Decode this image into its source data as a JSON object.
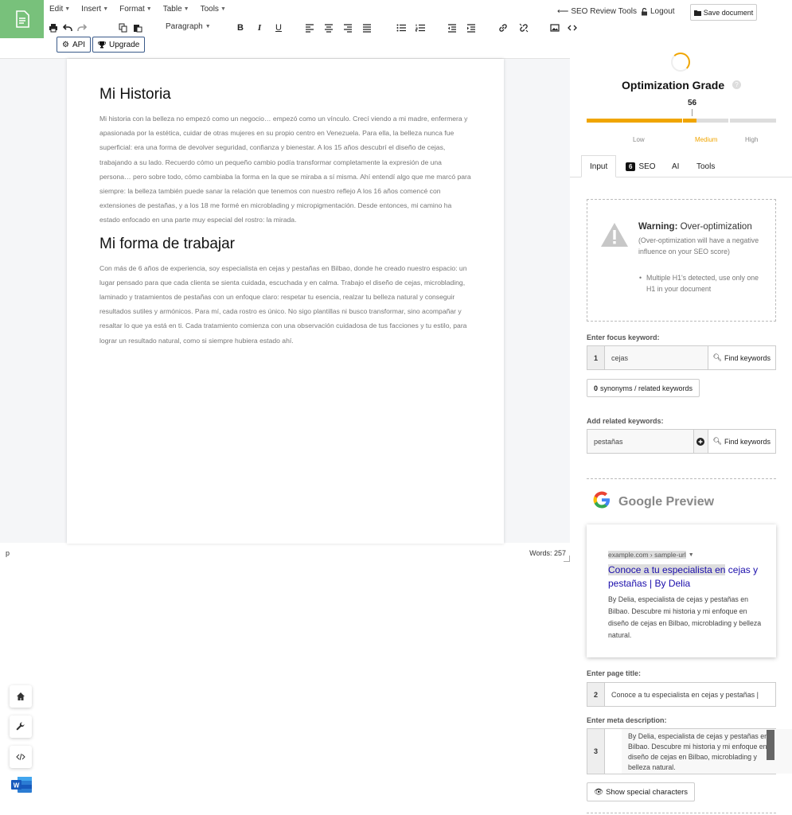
{
  "menu": {
    "edit": "Edit",
    "insert": "Insert",
    "format": "Format",
    "table": "Table",
    "tools": "Tools"
  },
  "toolbar": {
    "paragraph_select": "Paragraph",
    "bold": "B",
    "italic": "I",
    "underline": "U",
    "api_label": "API",
    "upgrade_label": "Upgrade"
  },
  "header": {
    "back_link": "SEO Review Tools",
    "logout": "Logout",
    "save": "Save document"
  },
  "editor": {
    "heading1": "Mi Historia",
    "paragraph1": "Mi historia con la belleza no empezó como un negocio… empezó como un vínculo. Crecí viendo a mi madre, enfermera y apasionada por la estética, cuidar de otras mujeres en su propio centro en Venezuela. Para ella, la belleza nunca fue superficial: era una forma de devolver seguridad, confianza y bienestar. A los 15 años descubrí el diseño de cejas, trabajando a su lado. Recuerdo cómo un pequeño cambio podía transformar completamente la expresión de una persona… pero sobre todo, cómo cambiaba la forma en la que se miraba a sí misma. Ahí entendí algo que me marcó para siempre: la belleza también puede sanar la relación que tenemos con nuestro reflejo A los 16 años comencé con extensiones de pestañas, y a los 18 me formé en microblading y micropigmentación. Desde entonces, mi camino ha estado enfocado en una parte muy especial del rostro: la mirada.",
    "heading2": "Mi forma de trabajar",
    "paragraph2": "Con más de 6 años de experiencia, soy especialista en cejas y pestañas en Bilbao, donde he creado nuestro espacio: un lugar pensado para que cada clienta se sienta cuidada, escuchada y en calma. Trabajo el diseño de cejas, microblading, laminado y tratamientos de pestañas con un enfoque claro: respetar tu esencia, realzar tu belleza natural y conseguir resultados sutiles y armónicos. Para mí, cada rostro es único. No sigo plantillas ni busco transformar, sino acompañar y resaltar lo que ya está en ti. Cada tratamiento comienza con una observación cuidadosa de tus facciones y tu estilo, para lograr un resultado natural, como si siempre hubiera estado ahí.",
    "status_path": "p",
    "word_count": "Words: 257"
  },
  "grade": {
    "title": "Optimization Grade",
    "help": "?",
    "value": "56",
    "progress": 0.56,
    "low": "Low",
    "medium": "Medium",
    "high": "High",
    "accent": "#f0a500"
  },
  "tabs": {
    "input": "Input",
    "seo_badge": "6",
    "seo": "SEO",
    "ai": "AI",
    "tools": "Tools"
  },
  "warning": {
    "title_bold": "Warning:",
    "title_rest": " Over-optimization",
    "description": "(Over-optimization will have a negative influence on your SEO score)",
    "bullet": "Multiple H1's detected, use only one H1 in your document"
  },
  "focus": {
    "label": "Enter focus keyword:",
    "num": "1",
    "value": "cejas",
    "find": "Find keywords",
    "synonyms_count": "0",
    "synonyms_label": " synonyms / related keywords"
  },
  "related": {
    "label": "Add related keywords:",
    "value": "pestañas",
    "find": "Find keywords"
  },
  "google": {
    "title": "Google Preview",
    "url": "example.com › sample-url",
    "serp_title_hl": "Conoce a tu especialista en",
    "serp_title_rest": " cejas y pestañas | By Delia",
    "serp_desc": "By Delia, especialista de cejas y pestañas en Bilbao. Descubre mi historia y mi enfoque en diseño de cejas en Bilbao, microblading y belleza natural."
  },
  "page_title": {
    "label": "Enter page title:",
    "num": "2",
    "value": "Conoce a tu especialista en cejas y pestañas |"
  },
  "meta": {
    "label": "Enter meta description:",
    "num": "3",
    "value": "By Delia, especialista de cejas y pestañas en Bilbao. Descubre mi historia y mi enfoque en diseño de cejas en Bilbao, microblading y belleza natural."
  },
  "special": {
    "label": "Show special characters"
  }
}
